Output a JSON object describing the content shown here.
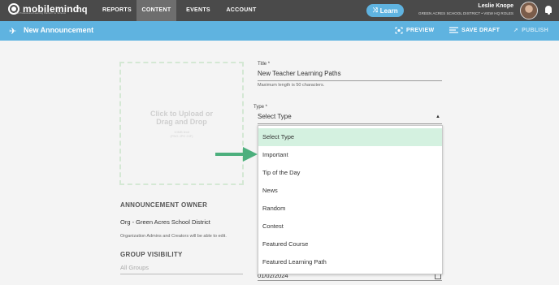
{
  "topnav": {
    "brand": "mobilemind",
    "tagline": "The Professional Learning Platform for Schools",
    "brand_suffix": "hq",
    "items": [
      {
        "label": "REPORTS"
      },
      {
        "label": "CONTENT"
      },
      {
        "label": "EVENTS"
      },
      {
        "label": "ACCOUNT"
      }
    ],
    "learn_label": "Learn",
    "user_name": "Leslie Knope",
    "user_sub": "GREEN ACRES SCHOOL DISTRICT • VIEW HQ ROLES"
  },
  "subheader": {
    "title": "New Announcement",
    "preview": "PREVIEW",
    "save_draft": "SAVE DRAFT",
    "publish": "PUBLISH"
  },
  "upload": {
    "main": "Click to Upload or Drag and Drop",
    "sub": "10MB limit\n(PNG JPG GIF)"
  },
  "form": {
    "title_label": "Title *",
    "title_value": "New Teacher Learning Paths",
    "title_help": "Maximum length is 50 characters.",
    "type_label": "Type *",
    "type_value": "Select Type"
  },
  "dropdown": {
    "options": [
      {
        "label": "Select Type"
      },
      {
        "label": "Important"
      },
      {
        "label": "Tip of the Day"
      },
      {
        "label": "News"
      },
      {
        "label": "Random"
      },
      {
        "label": "Contest"
      },
      {
        "label": "Featured Course"
      },
      {
        "label": "Featured Learning Path"
      }
    ]
  },
  "owner": {
    "heading": "ANNOUNCEMENT OWNER",
    "value": "Org - Green Acres School District",
    "help": "Organization Admins and Creators will be able to edit."
  },
  "visibility": {
    "heading": "GROUP VISIBILITY",
    "value": "All Groups"
  },
  "date": {
    "value": "01/02/2024"
  },
  "colors": {
    "nav_bg": "#4a4a4a",
    "accent": "#5fb3e0",
    "selected_option": "#d4f1e0",
    "arrow": "#4caf7d"
  }
}
